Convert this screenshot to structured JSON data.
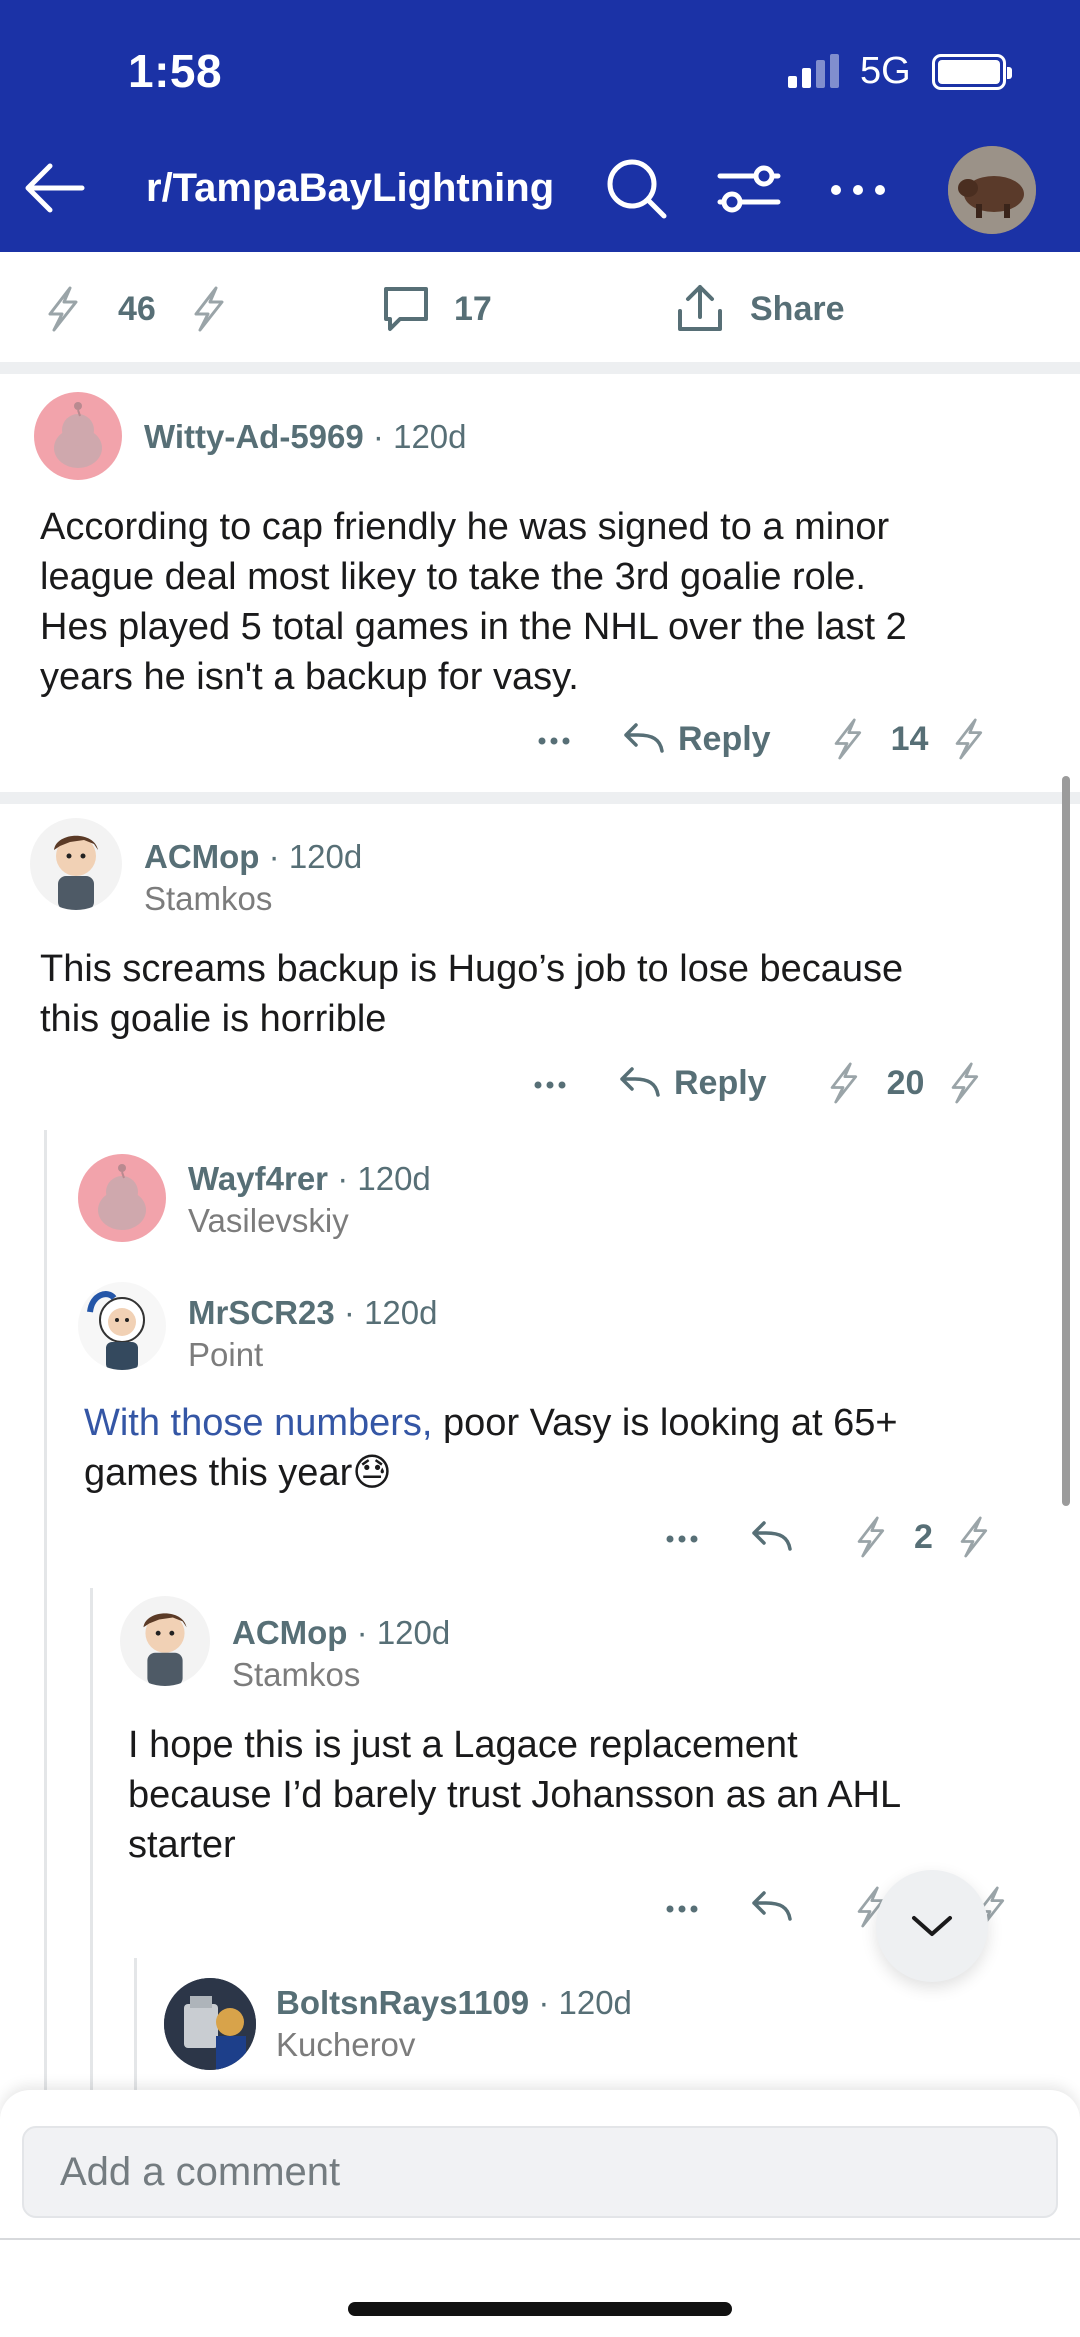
{
  "status_bar": {
    "time": "1:58",
    "network": "5G"
  },
  "header": {
    "subreddit": "r/TampaBayLightning"
  },
  "post_actions": {
    "votes": "46",
    "comments": "17",
    "share": "Share"
  },
  "colors": {
    "header_bg": "#1b32a6",
    "link": "#3456a5",
    "muted": "#576f76"
  },
  "comments": [
    {
      "author": "Witty-Ad-5969",
      "age": "120d",
      "flair": "",
      "lines": [
        "According to cap friendly he was signed to a minor",
        "league deal most likey to take the 3rd goalie role.",
        "Hes played 5 total games in the NHL over the last 2",
        "years he isn't a backup for vasy."
      ],
      "reply_label": "Reply",
      "score": "14"
    },
    {
      "author": "ACMop",
      "age": "120d",
      "flair": "Stamkos",
      "lines": [
        "This screams backup is Hugo’s job to lose because",
        "this goalie is horrible"
      ],
      "reply_label": "Reply",
      "score": "20"
    },
    {
      "author": "Wayf4rer",
      "age": "120d",
      "flair": "Vasilevskiy"
    },
    {
      "author": "MrSCR23",
      "age": "120d",
      "flair": "Point",
      "link_text": "With those numbers,",
      "line1_rest": " poor Vasy is looking at 65+",
      "line2": "games this year",
      "emoji": "😓",
      "score": "2"
    },
    {
      "author": "ACMop",
      "age": "120d",
      "flair": "Stamkos",
      "lines": [
        "I hope this is just a Lagace replacement",
        "because I’d barely trust Johansson as an AHL",
        "starter"
      ]
    },
    {
      "author": "BoltsnRays1109",
      "age": "120d",
      "flair": "Kucherov"
    }
  ],
  "composer": {
    "placeholder": "Add a comment"
  },
  "separator": "·",
  "icons": {
    "back": "arrow-left-icon",
    "search": "search-icon",
    "filter": "filter-icon",
    "more": "more-icon",
    "upvote": "lightning-upvote-icon",
    "downvote": "lightning-downvote-icon",
    "comment": "comment-bubble-icon",
    "share": "share-icon",
    "reply": "reply-arrow-icon",
    "chevron": "chevron-down-icon"
  }
}
